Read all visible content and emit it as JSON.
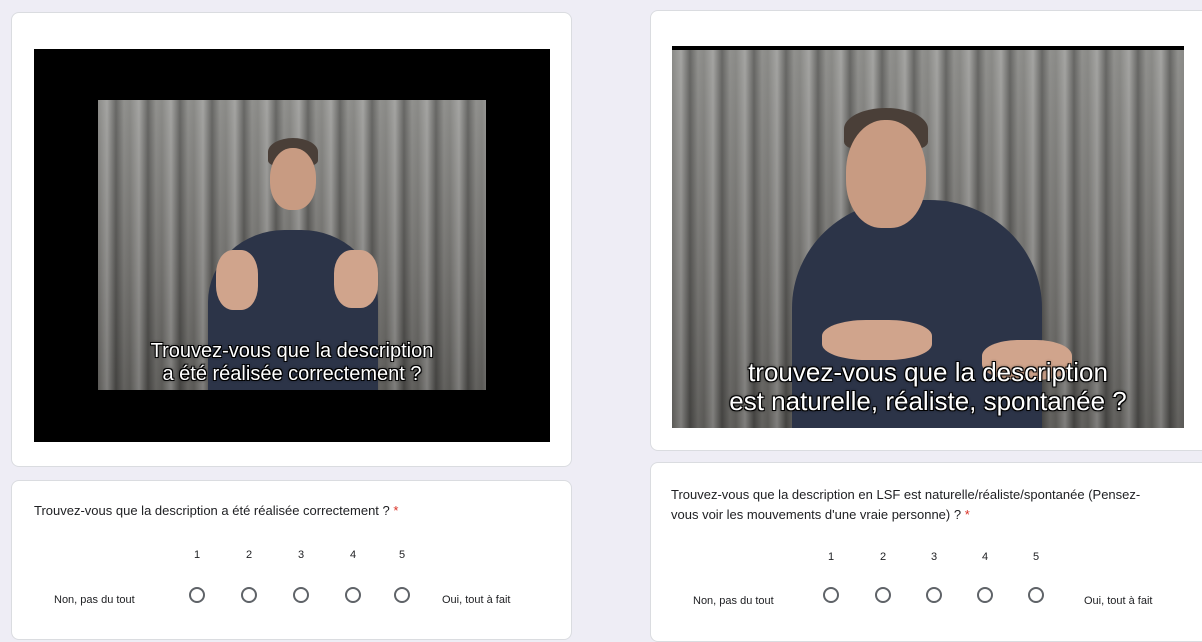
{
  "left": {
    "video": {
      "subtitle_line1": "Trouvez-vous que la description",
      "subtitle_line2": "a été réalisée correctement ?"
    },
    "question": {
      "text": "Trouvez-vous que la description a été réalisée correctement ?",
      "required_mark": "*",
      "scale": [
        "1",
        "2",
        "3",
        "4",
        "5"
      ],
      "low_label": "Non, pas du tout",
      "high_label": "Oui, tout à fait"
    }
  },
  "right": {
    "video": {
      "subtitle_line1": "trouvez-vous que la description",
      "subtitle_line2": "est naturelle, réaliste, spontanée ?"
    },
    "question": {
      "text_line1": "Trouvez-vous que la description en LSF est naturelle/réaliste/spontanée (Pensez-",
      "text_line2": "vous voir les mouvements d'une vraie personne) ?",
      "required_mark": "*",
      "scale": [
        "1",
        "2",
        "3",
        "4",
        "5"
      ],
      "low_label": "Non, pas du tout",
      "high_label": "Oui, tout à fait"
    }
  },
  "colors": {
    "page_bg": "#eeedf5",
    "card_bg": "#ffffff",
    "required": "#d93025",
    "radio_border": "#5f6368"
  }
}
